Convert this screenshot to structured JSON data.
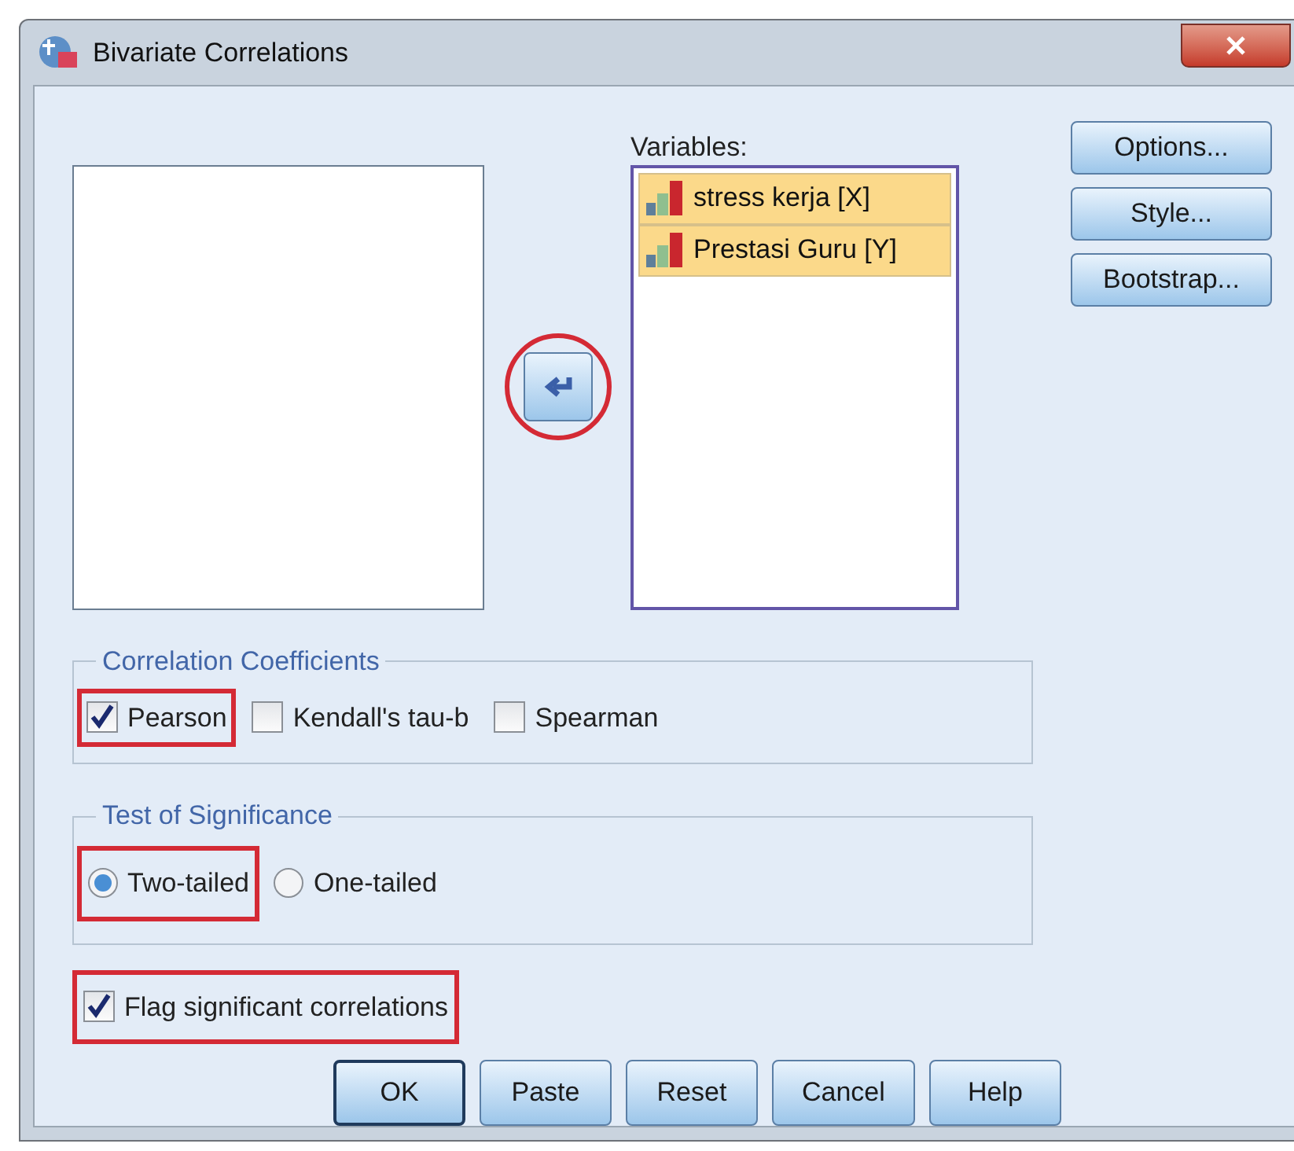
{
  "window": {
    "title": "Bivariate Correlations"
  },
  "move_button": {
    "highlighted": true
  },
  "variables": {
    "label": "Variables:",
    "items": [
      {
        "name": "stress kerja [X]",
        "selected": true
      },
      {
        "name": "Prestasi Guru [Y]",
        "selected": true
      }
    ]
  },
  "side_buttons": [
    "Options...",
    "Style...",
    "Bootstrap..."
  ],
  "correlation_coefficients": {
    "title": "Correlation Coefficients",
    "options": [
      {
        "label": "Pearson",
        "checked": true,
        "highlighted": true
      },
      {
        "label": "Kendall's tau-b",
        "checked": false,
        "highlighted": false
      },
      {
        "label": "Spearman",
        "checked": false,
        "highlighted": false
      }
    ]
  },
  "test_of_significance": {
    "title": "Test of Significance",
    "options": [
      {
        "label": "Two-tailed",
        "selected": true,
        "highlighted": true
      },
      {
        "label": "One-tailed",
        "selected": false,
        "highlighted": false
      }
    ]
  },
  "flag": {
    "label": "Flag significant correlations",
    "checked": true,
    "highlighted": true
  },
  "buttons": [
    {
      "label": "OK",
      "default": true
    },
    {
      "label": "Paste",
      "default": false
    },
    {
      "label": "Reset",
      "default": false
    },
    {
      "label": "Cancel",
      "default": false
    },
    {
      "label": "Help",
      "default": false
    }
  ]
}
